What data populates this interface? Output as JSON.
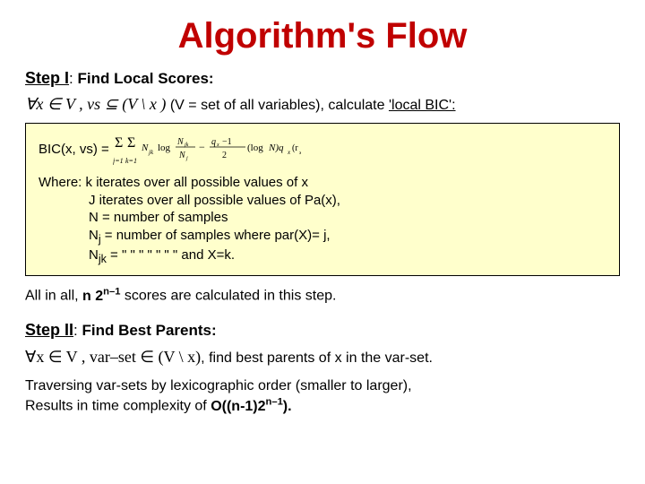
{
  "title": "Algorithm's Flow",
  "step1": {
    "label": "Step I",
    "heading": "Find Local Scores:",
    "cond_prefix": "∀x ∈ V ,  vs ⊆ (V  \\ x )",
    "cond_suffix": "(V = set of all variables), calculate ",
    "cond_link": "'local BIC':"
  },
  "box": {
    "bic_label": "BIC(x, vs) =",
    "where": "Where:",
    "k_line": "k  iterates over all possible values of x",
    "j_line": "J iterates over all possible values of Pa(x),",
    "n_line": "N  = number of samples",
    "nj_line_a": "N",
    "nj_line_b": " = number of samples where par(X)= j,",
    "njk_line_a": "N",
    "njk_line_b": " =      \"              \"       \"                    \"         \"       \"     \" and X=k."
  },
  "summary": {
    "prefix": "All in all, ",
    "bold1": "n 2",
    "exp": "n–1",
    "suffix": " scores are calculated in this step."
  },
  "step2": {
    "label": "Step II",
    "heading": "Find Best Parents:",
    "math": "∀x ∈ V , var–set ∈ (V \\ x)",
    "text": ", find best parents of x in the var-set.",
    "line2a": "Traversing var-sets by lexicographic order (smaller to larger),",
    "line2b": "Results in time complexity of ",
    "bigO": "O((n-1)2",
    "bigOexp": "n–1",
    "bigOend": ")."
  }
}
